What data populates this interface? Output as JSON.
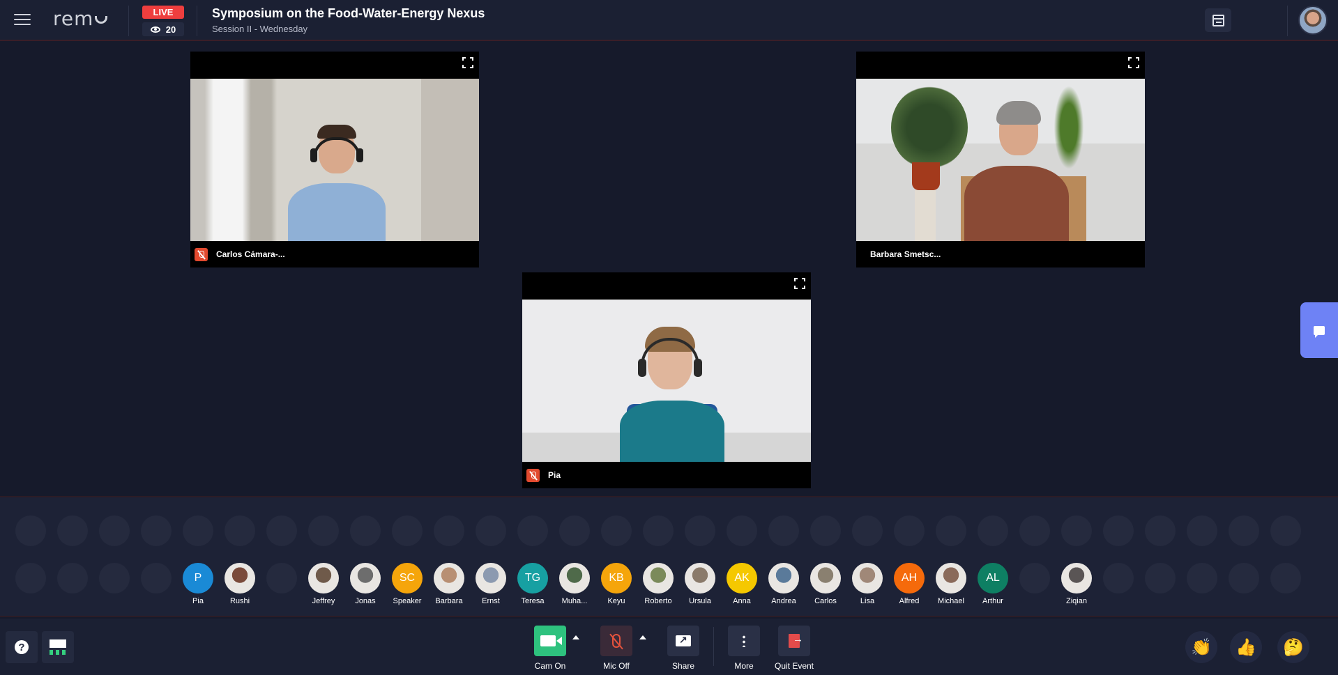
{
  "header": {
    "live_label": "LIVE",
    "viewer_count": "20",
    "event_title": "Symposium on the Food-Water-Energy Nexus",
    "event_subtitle": "Session II - Wednesday",
    "logo_text": "rem"
  },
  "icons": [
    "menu-icon",
    "eye-icon",
    "calendar-icon",
    "expand-icon",
    "mic-muted-icon",
    "chat-icon",
    "help-icon",
    "stage-icon",
    "camera-icon",
    "mic-off-icon",
    "share-screen-icon",
    "more-icon",
    "quit-icon",
    "clap-icon",
    "thumbs-up-icon",
    "thinking-icon"
  ],
  "tiles": [
    {
      "name": "Carlos Cámara-...",
      "muted": true
    },
    {
      "name": "Barbara Smetsc...",
      "muted": false
    },
    {
      "name": "Pia",
      "muted": true
    }
  ],
  "attendees": [
    {
      "label": "Pia",
      "initials": "P",
      "color": "#1a8ad6"
    },
    {
      "label": "Rushi",
      "initials": "",
      "color": "#7a4a3a"
    },
    {
      "label": "Jeffrey",
      "initials": "",
      "color": "#6f5a4a"
    },
    {
      "label": "Jonas",
      "initials": "",
      "color": "#6d6d6d"
    },
    {
      "label": "Speaker",
      "initials": "SC",
      "color": "#f5a50b"
    },
    {
      "label": "Barbara",
      "initials": "",
      "color": "#b88f73"
    },
    {
      "label": "Ernst",
      "initials": "",
      "color": "#8c9ab0"
    },
    {
      "label": "Teresa",
      "initials": "TG",
      "color": "#17a0a2"
    },
    {
      "label": "Muha...",
      "initials": "",
      "color": "#4f6a4a"
    },
    {
      "label": "Keyu",
      "initials": "KB",
      "color": "#f5a50b"
    },
    {
      "label": "Roberto",
      "initials": "",
      "color": "#7b8a5a"
    },
    {
      "label": "Ursula",
      "initials": "",
      "color": "#8a7a6a"
    },
    {
      "label": "Anna",
      "initials": "AK",
      "color": "#f5c800"
    },
    {
      "label": "Andrea",
      "initials": "",
      "color": "#5a7a9a"
    },
    {
      "label": "Carlos",
      "initials": "",
      "color": "#8a8070"
    },
    {
      "label": "Lisa",
      "initials": "",
      "color": "#a08878"
    },
    {
      "label": "Alfred",
      "initials": "AH",
      "color": "#f56a0b"
    },
    {
      "label": "Michael",
      "initials": "",
      "color": "#8a6a5a"
    },
    {
      "label": "Arthur",
      "initials": "AL",
      "color": "#0e7f63"
    },
    {
      "label": "Ziqian",
      "initials": "",
      "color": "#5a5555"
    }
  ],
  "toolbar": {
    "cam_label": "Cam On",
    "mic_label": "Mic Off",
    "share_label": "Share",
    "more_label": "More",
    "quit_label": "Quit Event",
    "help_glyph": "?",
    "cam_color": "#2ec27e",
    "mic_color": "#e5533d",
    "quit_color": "#e34b4b",
    "reactions": [
      "👏",
      "👍",
      "🤔"
    ]
  },
  "colors": {
    "background": "#161a2b",
    "header": "#1b2033",
    "live": "#ee3e3e",
    "chat_button": "#6e82f5"
  }
}
